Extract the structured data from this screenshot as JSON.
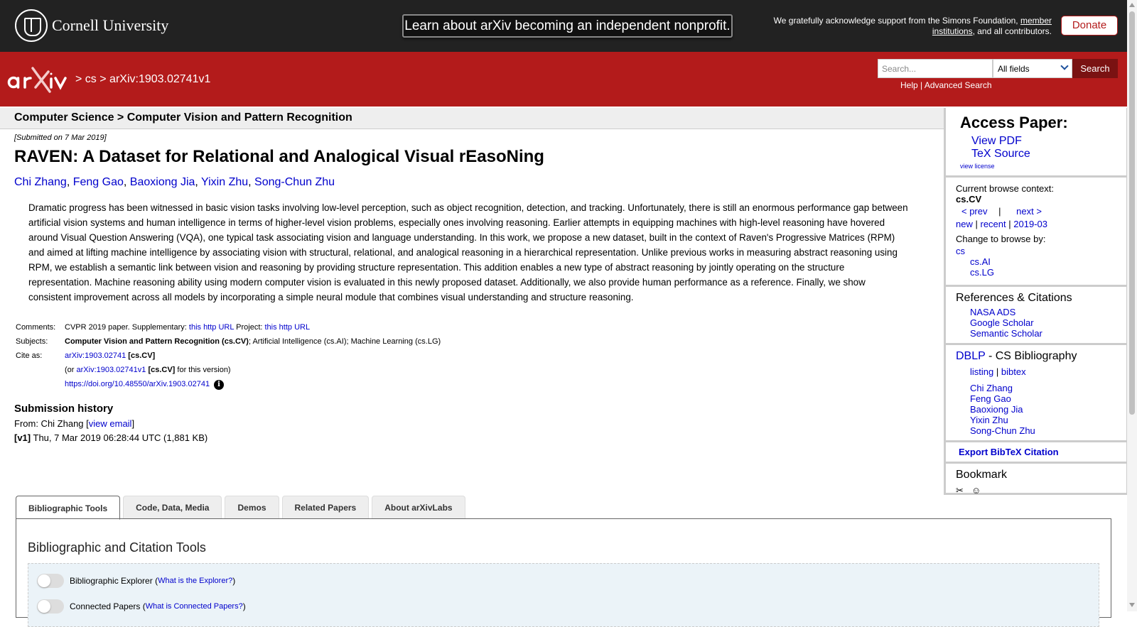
{
  "topbar": {
    "cornell_text": "Cornell University",
    "notice": "Learn about arXiv becoming an independent nonprofit.",
    "ack_prefix": "We gratefully acknowledge support from the Simons Foundation,",
    "ack_link": "member institutions",
    "ack_suffix": ", and all contributors.",
    "donate": "Donate"
  },
  "header": {
    "crumb_sep1": ">",
    "crumb_cs": "cs",
    "crumb_sep2": ">",
    "crumb_id": "arXiv:1903.02741v1",
    "search_placeholder": "Search...",
    "search_field": "All fields",
    "search_button": "Search",
    "help": "Help",
    "divider": "|",
    "advanced": "Advanced Search",
    "brand_color": "#b31b1b"
  },
  "subject_bar": "Computer Science > Computer Vision and Pattern Recognition",
  "paper": {
    "submitted": "[Submitted on 7 Mar 2019]",
    "title": "RAVEN: A Dataset for Relational and Analogical Visual rEasoNing",
    "authors": [
      "Chi Zhang",
      "Feng Gao",
      "Baoxiong Jia",
      "Yixin Zhu",
      "Song-Chun Zhu"
    ],
    "author_sep": ",",
    "abstract": "Dramatic progress has been witnessed in basic vision tasks involving low-level perception, such as object recognition, detection, and tracking. Unfortunately, there is still an enormous performance gap between artificial vision systems and human intelligence in terms of higher-level vision problems, especially ones involving reasoning. Earlier attempts in equipping machines with high-level reasoning have hovered around Visual Question Answering (VQA), one typical task associating vision and language understanding. In this work, we propose a new dataset, built in the context of Raven's Progressive Matrices (RPM) and aimed at lifting machine intelligence by associating vision with structural, relational, and analogical reasoning in a hierarchical representation. Unlike previous works in measuring abstract reasoning using RPM, we establish a semantic link between vision and reasoning by providing structure representation. This addition enables a new type of abstract reasoning by jointly operating on the structure representation. Machine reasoning ability using modern computer vision is evaluated in this newly proposed dataset. Additionally, we also provide human performance as a reference. Finally, we show consistent improvement across all models by incorporating a simple neural module that combines visual understanding and structure reasoning."
  },
  "meta": {
    "comments_label": "Comments:",
    "comments_prefix": "CVPR 2019 paper. Supplementary:",
    "comments_link1": "this http URL",
    "comments_mid": "Project:",
    "comments_link2": "this http URL",
    "subjects_label": "Subjects:",
    "subjects_primary": "Computer Vision and Pattern Recognition (cs.CV)",
    "subjects_rest": "; Artificial Intelligence (cs.AI); Machine Learning (cs.LG)",
    "cite_label": "Cite as:",
    "cite_id": "arXiv:1903.02741",
    "cite_tag": "[cs.CV]",
    "cite_or": "(or",
    "cite_v1": "arXiv:1903.02741v1",
    "cite_v1_tag": "[cs.CV]",
    "cite_v1_suffix": "for this version)",
    "doi": "https://doi.org/10.48550/arXiv.1903.02741"
  },
  "history": {
    "heading": "Submission history",
    "from_prefix": "From: Chi Zhang [",
    "view_email": "view email",
    "from_suffix": "]",
    "v1_tag": "[v1]",
    "v1_text": "Thu, 7 Mar 2019 06:28:44 UTC (1,881 KB)"
  },
  "sidebar": {
    "access_heading": "Access Paper:",
    "view_pdf": "View PDF",
    "tex_source": "TeX Source",
    "view_license": "view license",
    "context_label": "Current browse context:",
    "context_value": "cs.CV",
    "prev": "< prev",
    "bar": "|",
    "next": "next >",
    "new": "new",
    "recent": "recent",
    "month": "2019-03",
    "change_label": "Change to browse by:",
    "browse": [
      "cs",
      "cs.AI",
      "cs.LG"
    ],
    "refs_heading": "References & Citations",
    "refs": [
      "NASA ADS",
      "Google Scholar",
      "Semantic Scholar"
    ],
    "dblp": "DBLP",
    "dblp_suffix": " - CS Bibliography",
    "listing": "listing",
    "bibtex": "bibtex",
    "dblp_authors": [
      "Chi Zhang",
      "Feng Gao",
      "Baoxiong Jia",
      "Yixin Zhu",
      "Song-Chun Zhu"
    ],
    "export": "Export BibTeX Citation",
    "bookmark": "Bookmark"
  },
  "tabs": [
    "Bibliographic Tools",
    "Code, Data, Media",
    "Demos",
    "Related Papers",
    "About arXivLabs"
  ],
  "panel": {
    "heading": "Bibliographic and Citation Tools",
    "explorer_label": "Bibliographic Explorer",
    "explorer_link": "What is the Explorer?",
    "connected_label": "Connected Papers",
    "connected_link": "What is Connected Papers?",
    "open_paren": "(",
    "close_paren": ")"
  }
}
